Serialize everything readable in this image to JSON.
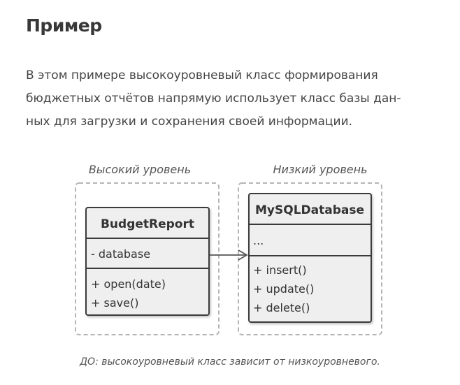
{
  "section_title": "Пример",
  "paragraph": {
    "lines": [
      "В этом примере высокоуровневый класс формирования",
      "бюджетных отчётов напрямую использует класс базы дан-",
      "ных для загрузки и сохранения своей информации."
    ]
  },
  "diagram": {
    "left_group_label": "Высокий уровень",
    "right_group_label": "Низкий уровень",
    "budget_report": {
      "name": "BudgetReport",
      "field": "- database",
      "methods": [
        "+ open(date)",
        "+ save()"
      ]
    },
    "mysql_database": {
      "name": "MySQLDatabase",
      "field": "...",
      "methods": [
        "+ insert()",
        "+ update()",
        "+ delete()"
      ]
    },
    "colors": {
      "box_fill": "#efefef",
      "box_stroke": "#3a3a3a",
      "dashed_stroke": "#b5b5b5",
      "arrow": "#555555"
    }
  },
  "caption": "ДО: высокоуровневый класс зависит от низкоуровневого."
}
